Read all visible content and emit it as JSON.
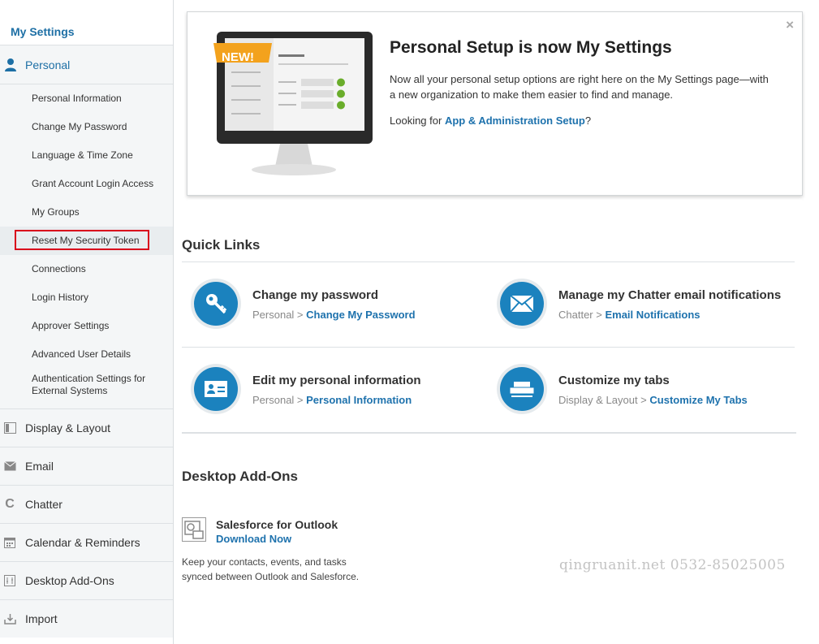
{
  "sidebar": {
    "title": "My Settings",
    "personal_label": "Personal",
    "personal_items": [
      "Personal Information",
      "Change My Password",
      "Language & Time Zone",
      "Grant Account Login Access",
      "My Groups",
      "Reset My Security Token",
      "Connections",
      "Login History",
      "Approver Settings",
      "Advanced User Details",
      "Authentication Settings for External Systems"
    ],
    "sections": [
      {
        "label": "Display & Layout",
        "icon": "layout-icon"
      },
      {
        "label": "Email",
        "icon": "email-icon"
      },
      {
        "label": "Chatter",
        "icon": "chatter-icon"
      },
      {
        "label": "Calendar & Reminders",
        "icon": "calendar-icon"
      },
      {
        "label": "Desktop Add-Ons",
        "icon": "desktop-addons-icon"
      },
      {
        "label": "Import",
        "icon": "import-icon"
      }
    ]
  },
  "banner": {
    "badge": "NEW!",
    "title": "Personal Setup is now My Settings",
    "text": "Now all your personal setup options are right here on the My Settings page—with a new organization to make them easier to find and manage.",
    "looking_for": "Looking for",
    "link": "App & Administration Setup",
    "question": "?",
    "close": "×"
  },
  "quick_links": {
    "title": "Quick Links",
    "items": [
      {
        "title": "Change my password",
        "prefix": "Personal",
        "link": "Change My Password",
        "icon": "key-icon"
      },
      {
        "title": "Manage my Chatter email notifications",
        "prefix": "Chatter",
        "link": "Email Notifications",
        "icon": "envelope-icon"
      },
      {
        "title": "Edit my personal information",
        "prefix": "Personal",
        "link": "Personal Information",
        "icon": "id-card-icon"
      },
      {
        "title": "Customize my tabs",
        "prefix": "Display & Layout",
        "link": "Customize My Tabs",
        "icon": "tabs-icon"
      }
    ],
    "separator": " > "
  },
  "desktop_addons": {
    "title": "Desktop Add-Ons",
    "name": "Salesforce for Outlook",
    "link": "Download Now",
    "desc": "Keep your contacts, events, and tasks synced between Outlook and Salesforce."
  },
  "watermark": "qingruanit.net 0532-85025005",
  "colors": {
    "accent": "#1e72ad",
    "icon_blue": "#1b82be",
    "highlight": "#d9001b"
  }
}
